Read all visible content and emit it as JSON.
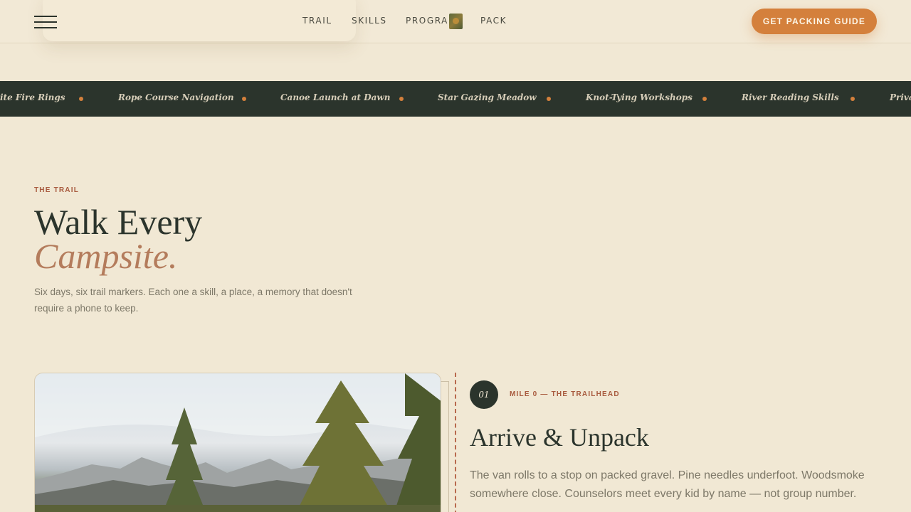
{
  "header": {
    "nav": [
      "TRAIL",
      "SKILLS",
      "PROGRAM",
      "PACK"
    ],
    "cta_label": "GET PACKING GUIDE"
  },
  "marquee": {
    "items": [
      "ite Fire Rings",
      "Rope Course Navigation",
      "Canoe Launch at Dawn",
      "Star Gazing Meadow",
      "Knot-Tying Workshops",
      "River Reading Skills",
      "Priva"
    ]
  },
  "intro": {
    "eyebrow": "THE TRAIL",
    "title_line1": "Walk Every",
    "title_line2": "Campsite.",
    "lede": "Six days, six trail markers. Each one a skill, a place, a memory that doesn't require a phone to keep."
  },
  "step": {
    "number": "01",
    "eyebrow": "MILE 0 — THE TRAILHEAD",
    "title": "Arrive & Unpack",
    "body": "The van rolls to a stop on packed gravel. Pine needles underfoot. Woodsmoke somewhere close. Counselors meet every kid by name — not group number."
  },
  "colors": {
    "background": "#f1e8d4",
    "dark": "#2b342c",
    "accent": "#d4803c",
    "eyebrow": "#a85a3e",
    "title_italic": "#b47c5c"
  },
  "icons": {
    "menu": "menu-icon",
    "badge": "program-thumbnail-icon"
  }
}
